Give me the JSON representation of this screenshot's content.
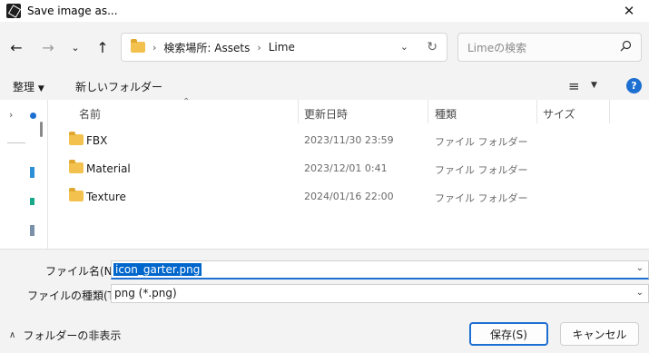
{
  "window": {
    "title": "Save image as..."
  },
  "nav": {
    "back_icon": "arrow-left-icon",
    "forward_icon": "arrow-right-icon",
    "recent_icon": "chevron-down-icon",
    "up_icon": "arrow-up-icon",
    "breadcrumbs": [
      "検索場所: Assets",
      "Lime"
    ],
    "search_placeholder": "Limeの検索"
  },
  "toolbar": {
    "organize": "整理",
    "new_folder": "新しいフォルダー"
  },
  "columns": {
    "name": "名前",
    "date": "更新日時",
    "type": "種類",
    "size": "サイズ"
  },
  "files": [
    {
      "name": "FBX",
      "date": "2023/11/30 23:59",
      "type": "ファイル フォルダー"
    },
    {
      "name": "Material",
      "date": "2023/12/01 0:41",
      "type": "ファイル フォルダー"
    },
    {
      "name": "Texture",
      "date": "2024/01/16 22:00",
      "type": "ファイル フォルダー"
    }
  ],
  "form": {
    "filename_label": "ファイル名(N):",
    "filename_value": "icon_garter.png",
    "filetype_label": "ファイルの種類(T):",
    "filetype_value": "png (*.png)",
    "hide_folders": "フォルダーの非表示",
    "save_button": "保存(S)",
    "cancel_button": "キャンセル"
  },
  "colors": {
    "accent": "#1d6fd1",
    "folder": "#f2c14e",
    "selection": "#0066cc"
  }
}
